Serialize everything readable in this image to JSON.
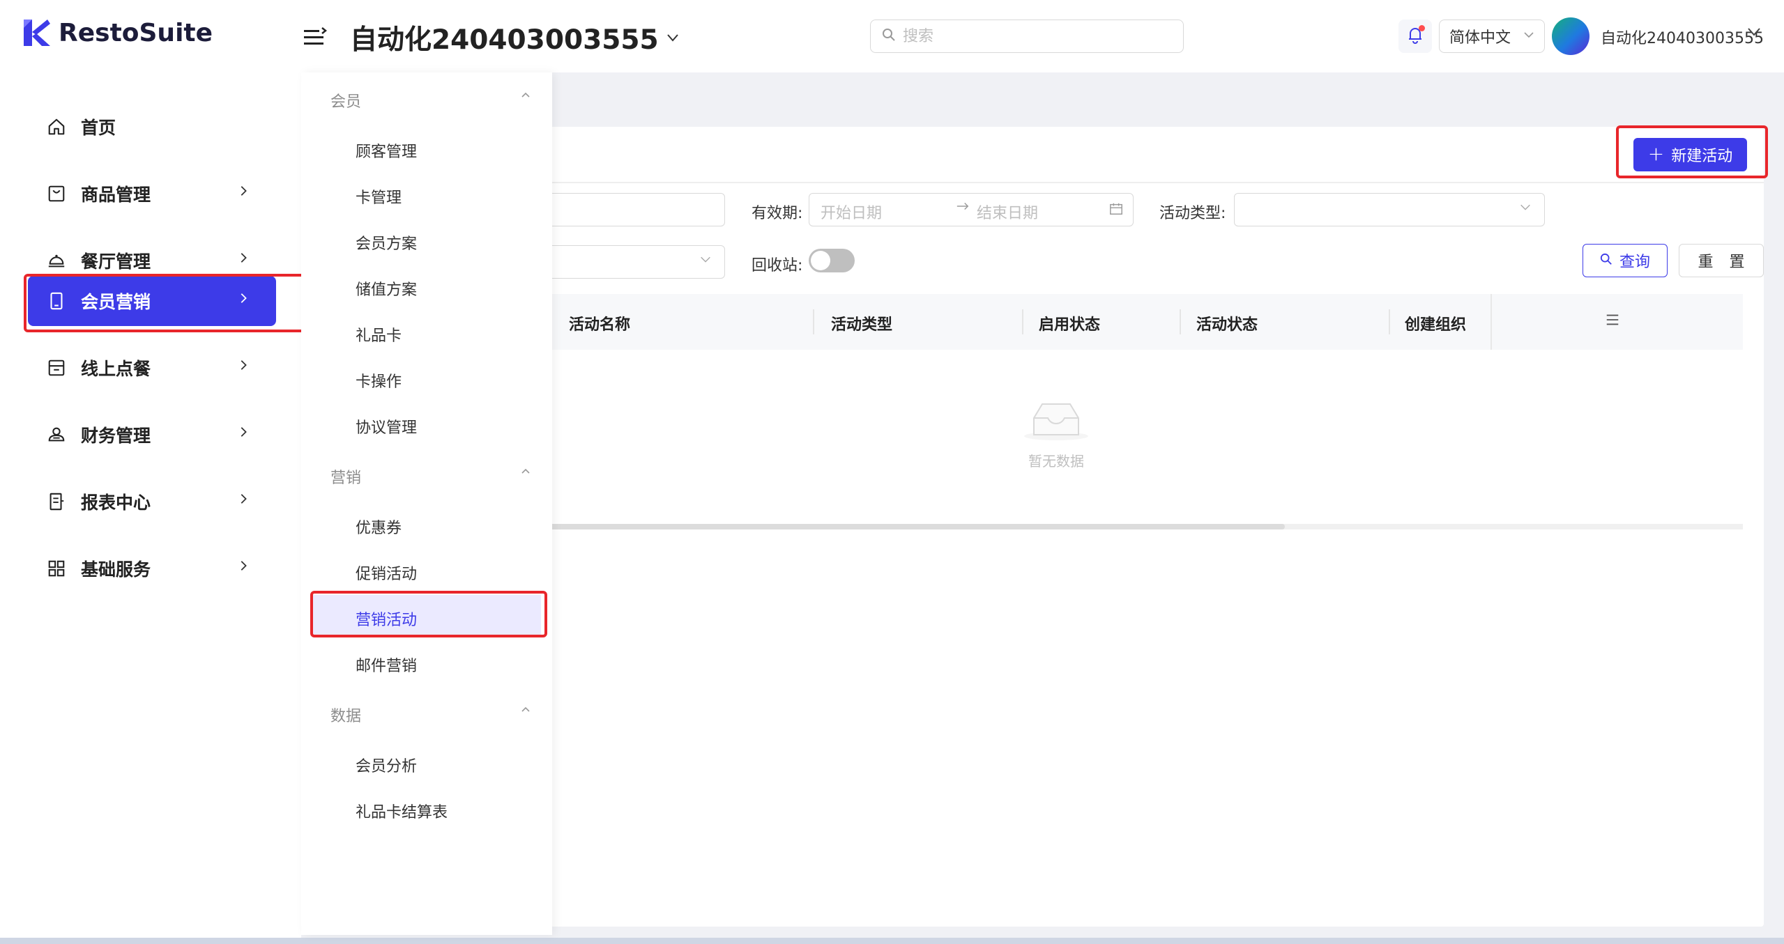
{
  "app": {
    "logo_text": "RestoSuite",
    "brand_color": "#3d3be8"
  },
  "header": {
    "store_name": "自动化240403003555",
    "search_placeholder": "搜索",
    "language": "简体中文",
    "user_name": "自动化240403003555"
  },
  "sidenav": {
    "items": [
      {
        "label": "首页",
        "icon": "home-icon",
        "has_children": false
      },
      {
        "label": "商品管理",
        "icon": "bag-icon",
        "has_children": true
      },
      {
        "label": "餐厅管理",
        "icon": "cloche-icon",
        "has_children": true
      },
      {
        "label": "会员营销",
        "icon": "tablet-icon",
        "has_children": true,
        "active": true
      },
      {
        "label": "线上点餐",
        "icon": "store-icon",
        "has_children": true
      },
      {
        "label": "财务管理",
        "icon": "finance-icon",
        "has_children": true
      },
      {
        "label": "报表中心",
        "icon": "report-icon",
        "has_children": true
      },
      {
        "label": "基础服务",
        "icon": "grid-icon",
        "has_children": true
      }
    ]
  },
  "submenu": {
    "groups": [
      {
        "title": "会员",
        "items": [
          "顾客管理",
          "卡管理",
          "会员方案",
          "储值方案",
          "礼品卡",
          "卡操作",
          "协议管理"
        ]
      },
      {
        "title": "营销",
        "items": [
          "优惠券",
          "促销活动",
          "营销活动",
          "邮件营销"
        ]
      },
      {
        "title": "数据",
        "items": [
          "会员分析",
          "礼品卡结算表"
        ]
      }
    ],
    "active_item": "营销活动"
  },
  "toolbar": {
    "new_button": "新建活动"
  },
  "filters": {
    "validity_label": "有效期:",
    "start_placeholder": "开始日期",
    "end_placeholder": "结束日期",
    "activity_type_label": "活动类型:",
    "recycle_label": "回收站:",
    "recycle_on": false,
    "query_button": "查询",
    "reset_button": "重 置"
  },
  "table": {
    "columns": [
      "活动名称",
      "活动类型",
      "启用状态",
      "活动状态",
      "创建组织"
    ],
    "empty_text": "暂无数据"
  }
}
